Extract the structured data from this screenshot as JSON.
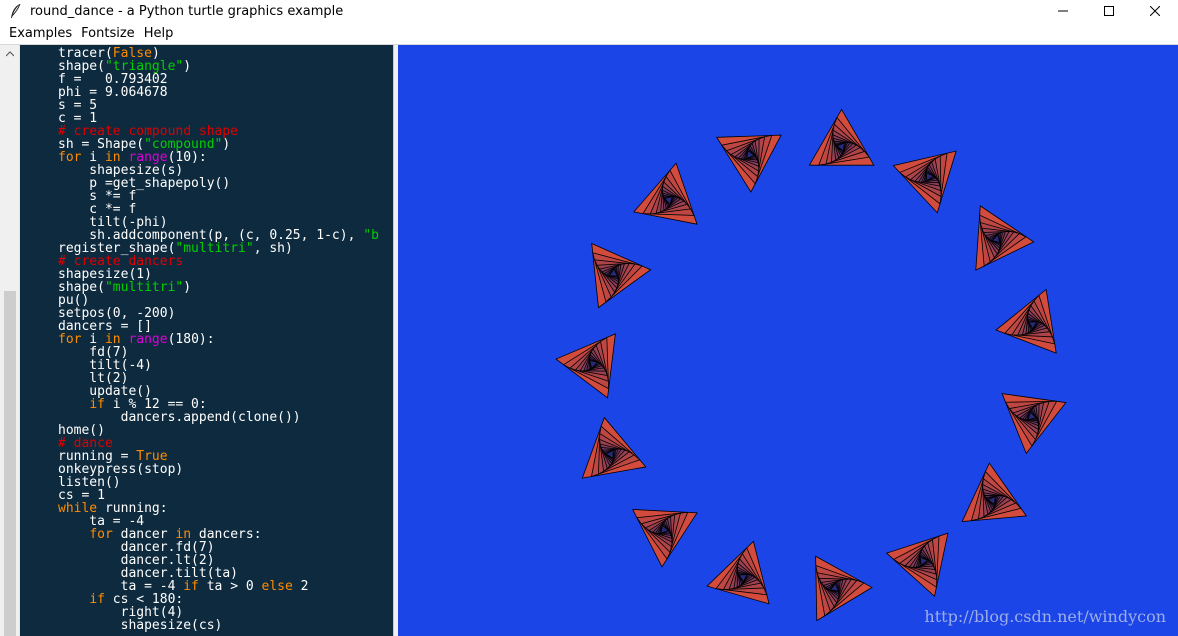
{
  "window": {
    "title": "round_dance - a Python turtle graphics example",
    "app_icon": "feather-icon"
  },
  "menu": [
    "Examples",
    "Fontsize",
    "Help"
  ],
  "colors": {
    "editor_bg": "#0e2a3e",
    "canvas_bg": "#1b45e6",
    "keyword": "#ff8c00",
    "string": "#00d000",
    "comment": "#dd0000",
    "builtin": "#dd00dd",
    "triangle_outer": "#d24b3c",
    "triangle_inner": "#2a2a7a"
  },
  "code_lines": [
    [
      {
        "t": "tracer("
      },
      {
        "t": "False",
        "c": "kw"
      },
      {
        "t": ")"
      }
    ],
    [
      {
        "t": "shape("
      },
      {
        "t": "\"triangle\"",
        "c": "str"
      },
      {
        "t": ")"
      }
    ],
    [
      {
        "t": "f =   0.793402"
      }
    ],
    [
      {
        "t": "phi = 9.064678"
      }
    ],
    [
      {
        "t": "s = 5"
      }
    ],
    [
      {
        "t": "c = 1"
      }
    ],
    [
      {
        "t": "# create compound shape",
        "c": "cm"
      }
    ],
    [
      {
        "t": "sh = Shape("
      },
      {
        "t": "\"compound\"",
        "c": "str"
      },
      {
        "t": ")"
      }
    ],
    [
      {
        "t": "for",
        "c": "kw"
      },
      {
        "t": " i "
      },
      {
        "t": "in",
        "c": "kw"
      },
      {
        "t": " "
      },
      {
        "t": "range",
        "c": "bi"
      },
      {
        "t": "(10):"
      }
    ],
    [
      {
        "t": "    shapesize(s)"
      }
    ],
    [
      {
        "t": "    p =get_shapepoly()"
      }
    ],
    [
      {
        "t": "    s *= f"
      }
    ],
    [
      {
        "t": "    c *= f"
      }
    ],
    [
      {
        "t": "    tilt(-phi)"
      }
    ],
    [
      {
        "t": "    sh.addcomponent(p, (c, 0.25, 1-c), "
      },
      {
        "t": "\"b",
        "c": "str"
      }
    ],
    [
      {
        "t": "register_shape("
      },
      {
        "t": "\"multitri\"",
        "c": "str"
      },
      {
        "t": ", sh)"
      }
    ],
    [
      {
        "t": "# create dancers",
        "c": "cm"
      }
    ],
    [
      {
        "t": "shapesize(1)"
      }
    ],
    [
      {
        "t": "shape("
      },
      {
        "t": "\"multitri\"",
        "c": "str"
      },
      {
        "t": ")"
      }
    ],
    [
      {
        "t": "pu()"
      }
    ],
    [
      {
        "t": "setpos(0, -200)"
      }
    ],
    [
      {
        "t": "dancers = []"
      }
    ],
    [
      {
        "t": "for",
        "c": "kw"
      },
      {
        "t": " i "
      },
      {
        "t": "in",
        "c": "kw"
      },
      {
        "t": " "
      },
      {
        "t": "range",
        "c": "bi"
      },
      {
        "t": "(180):"
      }
    ],
    [
      {
        "t": "    fd(7)"
      }
    ],
    [
      {
        "t": "    tilt(-4)"
      }
    ],
    [
      {
        "t": "    lt(2)"
      }
    ],
    [
      {
        "t": "    update()"
      }
    ],
    [
      {
        "t": "    "
      },
      {
        "t": "if",
        "c": "kw"
      },
      {
        "t": " i % 12 == 0:"
      }
    ],
    [
      {
        "t": "        dancers.append(clone())"
      }
    ],
    [
      {
        "t": "home()"
      }
    ],
    [
      {
        "t": "# dance",
        "c": "cm"
      }
    ],
    [
      {
        "t": "running = "
      },
      {
        "t": "True",
        "c": "kw"
      }
    ],
    [
      {
        "t": "onkeypress(stop)"
      }
    ],
    [
      {
        "t": "listen()"
      }
    ],
    [
      {
        "t": "cs = 1"
      }
    ],
    [
      {
        "t": "while",
        "c": "kw"
      },
      {
        "t": " running:"
      }
    ],
    [
      {
        "t": "    ta = -4"
      }
    ],
    [
      {
        "t": "    "
      },
      {
        "t": "for",
        "c": "kw"
      },
      {
        "t": " dancer "
      },
      {
        "t": "in",
        "c": "kw"
      },
      {
        "t": " dancers:"
      }
    ],
    [
      {
        "t": "        dancer.fd(7)"
      }
    ],
    [
      {
        "t": "        dancer.lt(2)"
      }
    ],
    [
      {
        "t": "        dancer.tilt(ta)"
      }
    ],
    [
      {
        "t": "        ta = -4 "
      },
      {
        "t": "if",
        "c": "kw"
      },
      {
        "t": " ta > 0 "
      },
      {
        "t": "else",
        "c": "kw"
      },
      {
        "t": " 2"
      }
    ],
    [
      {
        "t": "    "
      },
      {
        "t": "if",
        "c": "kw"
      },
      {
        "t": " cs < 180:"
      }
    ],
    [
      {
        "t": "        right(4)"
      }
    ],
    [
      {
        "t": "        shapesize(cs)"
      }
    ]
  ],
  "turtle_scene": {
    "dancer_count": 15,
    "layers_per_dancer": 10
  },
  "watermark": "http://blog.csdn.net/windycon"
}
